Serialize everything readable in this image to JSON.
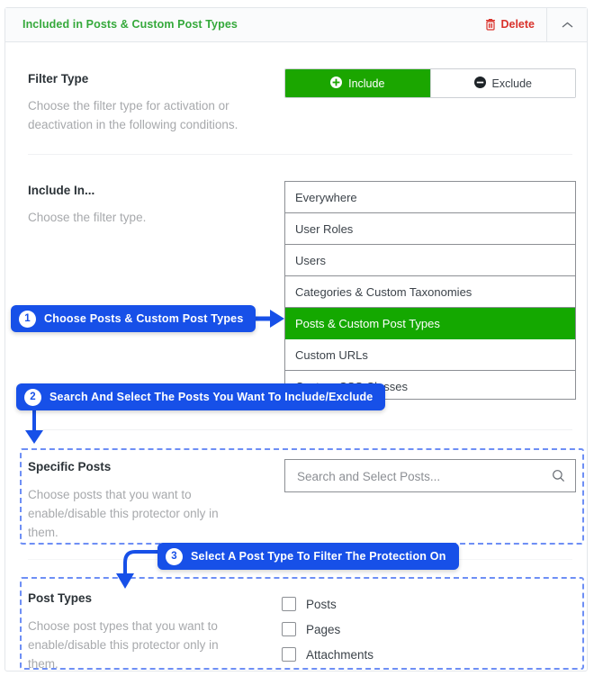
{
  "panel": {
    "title": "Included in Posts & Custom Post Types",
    "delete_label": "Delete",
    "delete_icon": "trash-icon",
    "collapse_icon": "chevron-up-icon",
    "accent_green": "#35a93b",
    "delete_red": "#d9322b"
  },
  "filter_type": {
    "label": "Filter Type",
    "description": "Choose the filter type for activation or deactivation in the following conditions.",
    "options": [
      {
        "label": "Include",
        "icon": "plus-circle-icon",
        "active": true
      },
      {
        "label": "Exclude",
        "icon": "minus-circle-icon",
        "active": false
      }
    ],
    "active_color": "#1ba600"
  },
  "include_in": {
    "label": "Include In...",
    "description": "Choose the filter type.",
    "selected": "Posts & Custom Post Types",
    "selected_color": "#14a800",
    "options": [
      {
        "label": "Everywhere",
        "selected": false
      },
      {
        "label": "User Roles",
        "selected": false
      },
      {
        "label": "Users",
        "selected": false
      },
      {
        "label": "Categories & Custom Taxonomies",
        "selected": false
      },
      {
        "label": "Posts & Custom Post Types",
        "selected": true
      },
      {
        "label": "Custom URLs",
        "selected": false
      },
      {
        "label": "Custom CSS Classes",
        "selected": false
      }
    ]
  },
  "specific_posts": {
    "label": "Specific Posts",
    "description": "Choose posts that you want to enable/disable this protector only in them.",
    "search_placeholder": "Search and Select Posts...",
    "search_value": "",
    "search_icon": "magnifier-icon"
  },
  "post_types": {
    "label": "Post Types",
    "description": "Choose post types that you want to enable/disable this protector only in them.",
    "checkboxes": [
      {
        "label": "Posts",
        "checked": false
      },
      {
        "label": "Pages",
        "checked": false
      },
      {
        "label": "Attachments",
        "checked": false
      }
    ]
  },
  "callouts": [
    {
      "number": "1",
      "text": "Choose Posts & Custom Post Types"
    },
    {
      "number": "2",
      "text": "Search And Select The Posts You Want To Include/Exclude"
    },
    {
      "number": "3",
      "text": "Select A Post Type To Filter The Protection On"
    }
  ],
  "callout_color": "#1750e8"
}
